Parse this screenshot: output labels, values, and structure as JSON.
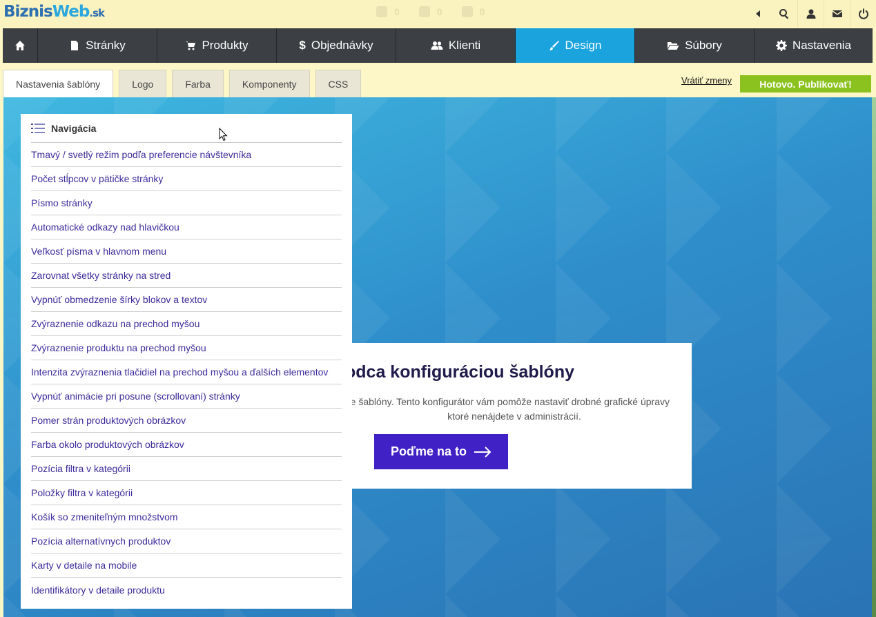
{
  "header": {
    "logo_part1": "Biznis",
    "logo_part2": "Web",
    "logo_part3": ".sk",
    "stats": [
      "0",
      "0",
      "0"
    ],
    "icons": [
      "back-arrow-icon",
      "search-icon",
      "user-icon",
      "mail-icon",
      "power-icon"
    ]
  },
  "mainnav": {
    "items": [
      {
        "label": "",
        "icon": "home-icon"
      },
      {
        "label": "Stránky",
        "icon": "page-icon"
      },
      {
        "label": "Produkty",
        "icon": "cart-icon"
      },
      {
        "label": "Objednávky",
        "icon": "dollar-icon"
      },
      {
        "label": "Klienti",
        "icon": "users-icon"
      },
      {
        "label": "Design",
        "icon": "brush-icon"
      },
      {
        "label": "Súbory",
        "icon": "folder-icon"
      },
      {
        "label": "Nastavenia",
        "icon": "gear-icon"
      }
    ],
    "active": "Design",
    "active_color": "#1aa3dd"
  },
  "subtabs": {
    "items": [
      "Nastavenia šablóny",
      "Logo",
      "Farba",
      "Komponenty",
      "CSS"
    ],
    "active": "Nastavenia šablóny"
  },
  "actions": {
    "revert": "Vrátiť zmeny",
    "publish": "Hotovo. Publikovať!",
    "publish_color": "#8cc21f"
  },
  "welcome": {
    "title": "odca konfiguráciou šablóny",
    "text_line1": "e šablóny. Tento konfigurátor vám pomôže nastaviť drobné grafické úpravy",
    "text_line2": "ktoré nenájdete v administrácií.",
    "cta": "Poďme na to",
    "cta_color": "#3f21c6"
  },
  "navpanel": {
    "title": "Navigácia",
    "items": [
      "Tmavý / svetlý režim podľa preferencie návštevníka",
      "Počet stĺpcov v pätičke stránky",
      "Písmo stránky",
      "Automatické odkazy nad hlavičkou",
      "Veľkosť písma v hlavnom menu",
      "Zarovnat všetky stránky na stred",
      "Vypnúť obmedzenie šírky blokov a textov",
      "Zvýraznenie odkazu na prechod myšou",
      "Zvýraznenie produktu na prechod myšou",
      "Intenzita zvýraznenia tlačidiel na prechod myšou a ďalších elementov",
      "Vypnúť animácie pri posune (scrollovaní) stránky",
      "Pomer strán produktových obrázkov",
      "Farba okolo produktových obrázkov",
      "Pozícia filtra v kategórii",
      "Položky filtra v kategórii",
      "Košík so zmeniteľným množstvom",
      "Pozícia alternatívnych produktov",
      "Karty v detaile na mobile",
      "Identifikátory v detaile produktu"
    ]
  }
}
